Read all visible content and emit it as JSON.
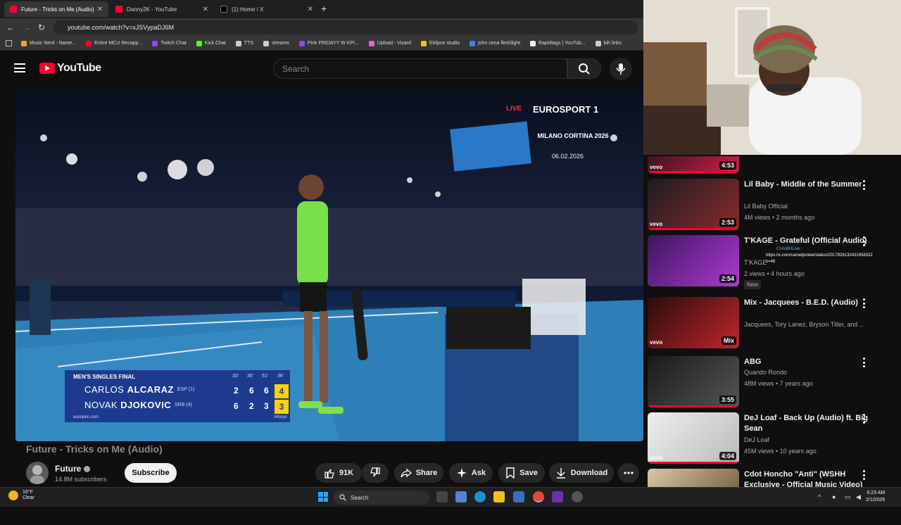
{
  "browser": {
    "tabs": [
      {
        "title": "Future - Tricks on Me (Audio) -",
        "active": true,
        "icon": "youtube-icon"
      },
      {
        "title": "Danny2K - YouTube",
        "active": false,
        "icon": "youtube-icon"
      },
      {
        "title": "(1) Home / X",
        "active": false,
        "icon": "x-icon"
      }
    ],
    "new_tab": "+",
    "close_glyph": "✕",
    "url": "youtube.com/watch?v=xJSVypaDJ6M",
    "bookmarks": [
      {
        "label": "Music Nerd - Name...",
        "color": "#f4a13b"
      },
      {
        "label": "Entire MCU Recapp...",
        "color": "#ff0033"
      },
      {
        "label": "Twitch Chat",
        "color": "#9146ff"
      },
      {
        "label": "Kick Chat",
        "color": "#53fc18"
      },
      {
        "label": "TTS",
        "color": "#cccccc"
      },
      {
        "label": "streams",
        "color": "#cccccc"
      },
      {
        "label": "Pink FRIDAYY W KPI...",
        "color": "#9146ff"
      },
      {
        "label": "Upload - Vizard",
        "color": "#e85fd8"
      },
      {
        "label": "Eklipse studio",
        "color": "#f2c21c"
      },
      {
        "label": "john cena fleshlight",
        "color": "#3b82f6"
      },
      {
        "label": "Rapidtags | YouTub...",
        "color": "#eeeeee"
      },
      {
        "label": "bih links",
        "color": "#cccccc"
      }
    ]
  },
  "youtube": {
    "logo_text": "YouTube",
    "search_placeholder": "Search",
    "video": {
      "title": "Future - Tricks on Me (Audio)",
      "channel": "Future",
      "subscribers": "14.8M subscribers",
      "subscribe_label": "Subscribe",
      "likes": "91K",
      "share_label": "Share",
      "ask_label": "Ask",
      "save_label": "Save",
      "download_label": "Download",
      "overlay": {
        "live": "LIVE",
        "broadcaster": "EUROSPORT 1",
        "event": "MILANO CORTINA 2026",
        "date": "06.02.2026",
        "scoreboard": {
          "heading": "MEN'S SINGLES FINAL",
          "set_headers": [
            "33'",
            "36'",
            "51'",
            "36'"
          ],
          "players": [
            {
              "first": "CARLOS",
              "last": "ALCARAZ",
              "seed": "ESP (1)",
              "sets": [
                "2",
                "6",
                "6"
              ],
              "current": "4"
            },
            {
              "first": "NOVAK",
              "last": "DJOKOVIC",
              "seed": "SRB (4)",
              "sets": [
                "6",
                "2",
                "3"
              ],
              "current": "3"
            }
          ],
          "footer": "ausopen.com",
          "sponsor": "infosys"
        }
      }
    },
    "recommendations": [
      {
        "title": "",
        "channel": "",
        "meta": "",
        "duration": "4:53",
        "vevo": "vevo",
        "thumb_colors": [
          "#3a1620",
          "#d21b4a"
        ]
      },
      {
        "title": "Lil Baby - Middle of the Summer",
        "channel": "Lil Baby Official",
        "meta": "4M views • 2 months ago",
        "duration": "2:53",
        "vevo": "vevo",
        "thumb_colors": [
          "#1c1c22",
          "#8a2a2a"
        ]
      },
      {
        "title": "T'KAGE - Grateful (Official Audio)",
        "channel": "T'KAGE",
        "meta": "2 views • 4 hours ago",
        "badge": "New",
        "duration": "2:54",
        "vevo": "",
        "thumb_colors": [
          "#3b1560",
          "#b03ad0"
        ]
      },
      {
        "title": "Mix - Jacquees - B.E.D. (Audio)",
        "channel": "Jacquees, Tory Lanez, Bryson Tiller, and ...",
        "meta": "",
        "duration": "Mix",
        "vevo": "vevo",
        "thumb_colors": [
          "#2a0c0c",
          "#c0262c"
        ]
      },
      {
        "title": "ABG",
        "channel": "Quando Rondo",
        "meta": "48M views • 7 years ago",
        "duration": "3:55",
        "vevo": "",
        "thumb_colors": [
          "#1a1a1a",
          "#555555"
        ]
      },
      {
        "title": "DeJ Loaf - Back Up (Audio) ft. Big Sean",
        "channel": "DeJ Loaf",
        "meta": "45M views • 10 years ago",
        "duration": "4:04",
        "vevo": "vevo",
        "thumb_colors": [
          "#eeeeee",
          "#bbbbbb"
        ]
      },
      {
        "title": "Cdot Honcho \"Anti\" (WSHH Exclusive - Official Music Video)",
        "channel": "",
        "meta": "",
        "duration": "",
        "vevo": "",
        "thumb_colors": [
          "#d8c8a8",
          "#7a6a4a"
        ]
      }
    ],
    "tweet_overlay": {
      "handle": "ChrisBHLive :",
      "url": "https://x.com/cameljockee/status/2017826132431958322",
      "suffix": "s=46"
    }
  },
  "taskbar": {
    "temperature": "16°F",
    "condition": "Clear",
    "search_label": "Search",
    "time": "6:23 AM",
    "date": "2/1/2026"
  }
}
